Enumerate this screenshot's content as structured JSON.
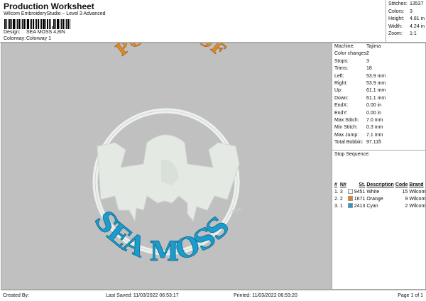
{
  "header": {
    "title": "Production Worksheet",
    "subtitle": "Wilcom EmbroideryStudio – Level 3 Advanced",
    "design_label": "Design:",
    "design_value": "SEA MOSS 4,8IN",
    "colorway_label": "Colorway:",
    "colorway_value": "Colorway 1"
  },
  "info": [
    {
      "label": "Stitches:",
      "value": "13537"
    },
    {
      "label": "Colors:",
      "value": "3"
    },
    {
      "label": "Height:",
      "value": "4.81 in"
    },
    {
      "label": "Width:",
      "value": "4.24 in"
    },
    {
      "label": "Zoom:",
      "value": "1:1"
    }
  ],
  "properties": [
    {
      "label": "Machine:",
      "value": "Tajima"
    },
    {
      "label": "Color changes:",
      "value": "2"
    },
    {
      "label": "Stops:",
      "value": "3"
    },
    {
      "label": "Trims:",
      "value": "18"
    },
    {
      "label": "Left:",
      "value": "53.9 mm"
    },
    {
      "label": "Right:",
      "value": "53.9 mm"
    },
    {
      "label": "Up:",
      "value": "61.1 mm"
    },
    {
      "label": "Down:",
      "value": "61.1 mm"
    },
    {
      "label": "EndX:",
      "value": "0.00 in"
    },
    {
      "label": "EndY:",
      "value": "0.00 in"
    },
    {
      "label": "Max Stitch:",
      "value": "7.0 mm"
    },
    {
      "label": "Min Stitch:",
      "value": "0.3 mm"
    },
    {
      "label": "Max Jump:",
      "value": "7.1 mm"
    },
    {
      "label": "Total Bobbin:",
      "value": "97.11ft"
    }
  ],
  "stop_sequence": {
    "title": "Stop Sequence:",
    "columns": [
      "#",
      "N#",
      "St.",
      "Description",
      "Code",
      "Brand"
    ],
    "rows": [
      {
        "idx": "1.",
        "n": "3",
        "st": "9451",
        "desc": "White",
        "code": "15",
        "brand": "Wilcom",
        "color": "#f4f4f4"
      },
      {
        "idx": "2.",
        "n": "2",
        "st": "1671",
        "desc": "Orange",
        "code": "9",
        "brand": "Wilcom",
        "color": "#e8801a"
      },
      {
        "idx": "3.",
        "n": "1",
        "st": "2413",
        "desc": "Cyan",
        "code": "2",
        "brand": "Wilcom",
        "color": "#1e9ad6"
      }
    ]
  },
  "logo": {
    "top_text": "POWER OF",
    "bottom_text": "SEA MOSS",
    "suffix": ".com",
    "top_color": "#e08a25",
    "bottom_color": "#1a9ccc",
    "white": "#e6ece6"
  },
  "footer": {
    "created_by": "Created By:",
    "last_saved": "Last Saved: 11/03/2022 06:53:17",
    "printed": "Printed: 11/03/2022 06:53:20",
    "page": "Page 1 of 1"
  }
}
